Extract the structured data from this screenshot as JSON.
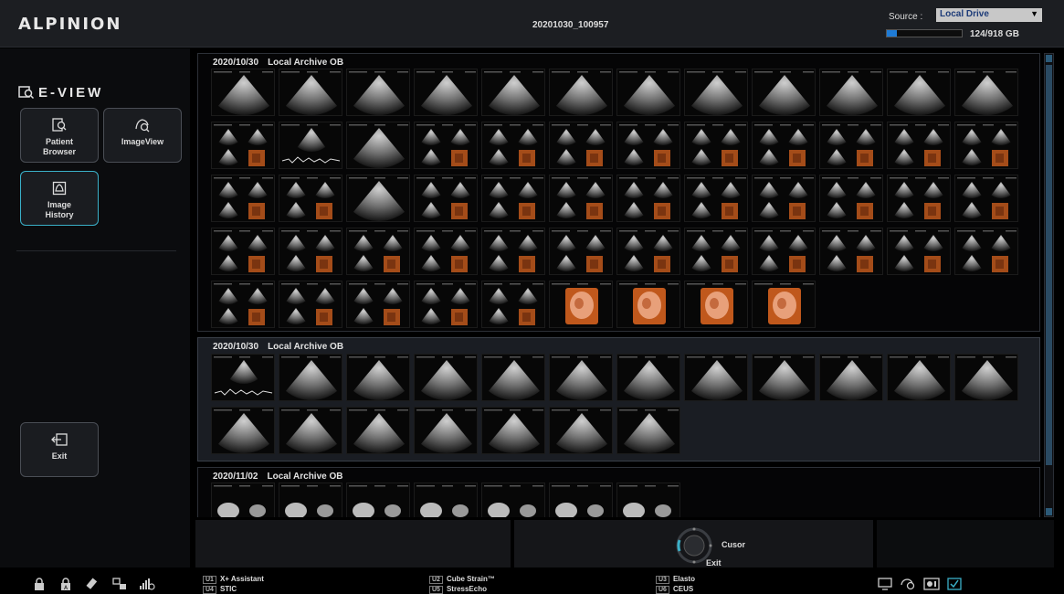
{
  "header": {
    "logo": "ALPINION",
    "study_id": "20201030_100957",
    "source_label": "Source :",
    "source_value": "Local Drive",
    "storage_text": "124/918 GB",
    "storage_used_fraction": 0.135
  },
  "sidebar": {
    "title": "E-VIEW",
    "buttons": [
      {
        "label_1": "Patient",
        "label_2": "Browser"
      },
      {
        "label_1": "ImageView",
        "label_2": ""
      },
      {
        "label_1": "Image",
        "label_2": "History"
      }
    ],
    "exit_label": "Exit"
  },
  "groups": [
    {
      "date": "2020/10/30",
      "archive": "Local Archive OB",
      "thumb_count": 57
    },
    {
      "date": "2020/10/30",
      "archive": "Local Archive OB",
      "thumb_count": 19
    },
    {
      "date": "2020/11/02",
      "archive": "Local Archive OB",
      "thumb_count": 7
    }
  ],
  "trackball": {
    "top_label": "Cusor",
    "bottom_label": "Exit"
  },
  "user_keys": [
    {
      "key": "U1",
      "label": "X+ Assistant"
    },
    {
      "key": "U4",
      "label": "STIC"
    },
    {
      "key": "U2",
      "label": "Cube Strain™"
    },
    {
      "key": "U5",
      "label": "StressEcho"
    },
    {
      "key": "U3",
      "label": "Elasto"
    },
    {
      "key": "U6",
      "label": "CEUS"
    }
  ],
  "colors": {
    "accent": "#3ab0c8",
    "storage_fill": "#1e7bd6",
    "select_text": "#1d3b78",
    "volume_render": "#c0581c"
  },
  "icons": {
    "status_left": [
      "lock-icon",
      "lock-a-icon",
      "usb-icon",
      "network-icon",
      "signal-icon"
    ],
    "status_right": [
      "monitor-icon",
      "probe-icon",
      "record-icon",
      "check-icon"
    ]
  }
}
